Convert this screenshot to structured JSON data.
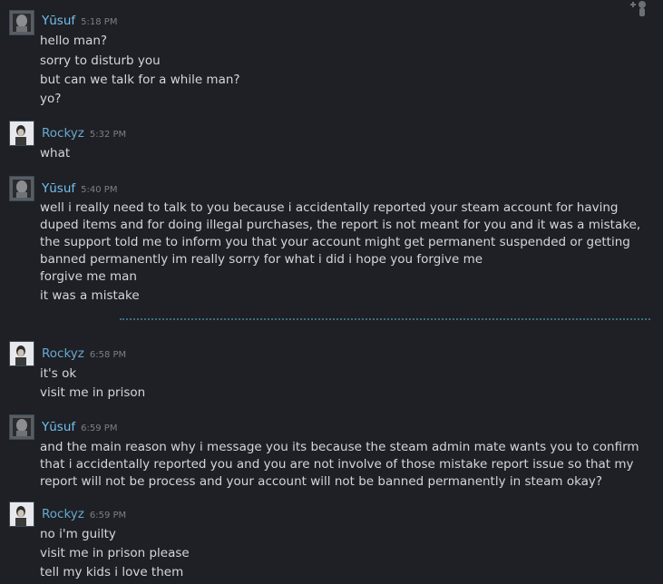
{
  "chat": {
    "groups": [
      {
        "author": "Yūsuf",
        "time": "5:18 PM",
        "messages": [
          "hello man?",
          "sorry to disturb you",
          "but can we talk for a while man?",
          "yo?"
        ]
      },
      {
        "author": "Rockyz",
        "time": "5:32 PM",
        "messages": [
          "what"
        ]
      },
      {
        "author": "Yūsuf",
        "time": "5:40 PM",
        "messages": [
          "well i really need to talk to you because i accidentally reported your steam account for having duped items and for doing illegal purchases, the report is not meant for you and it was a mistake, the support told me to inform you that your account might get permanent suspended or getting banned permanently im really sorry for what i did i hope you forgive me",
          "forgive me man",
          "it was a mistake"
        ]
      },
      {
        "author": "Rockyz",
        "time": "6:58 PM",
        "messages": [
          "it's ok",
          "visit me in prison"
        ]
      },
      {
        "author": "Yūsuf",
        "time": "6:59 PM",
        "messages": [
          "and the main reason why i message you its because the steam admin mate wants you to confirm that i accidentally reported you and you are not involve of those mistake report issue so that my report will not be process and your account will not be banned permanently in steam okay?"
        ]
      },
      {
        "author": "Rockyz",
        "time": "6:59 PM",
        "messages": [
          "no i'm guilty",
          "visit me in prison please",
          "tell my kids i love them"
        ]
      }
    ]
  },
  "icons": {
    "top_right": "add-friend-icon",
    "avatar_yusuf": "avatar-image",
    "avatar_rockyz": "avatar-image"
  },
  "colors": {
    "background": "#1e2025",
    "name_yusuf": "#74bff0",
    "name_rockyz": "#68a8cf",
    "message_text": "#d4d6da",
    "timestamp": "#7c7f86",
    "divider": "#3f6e80"
  }
}
